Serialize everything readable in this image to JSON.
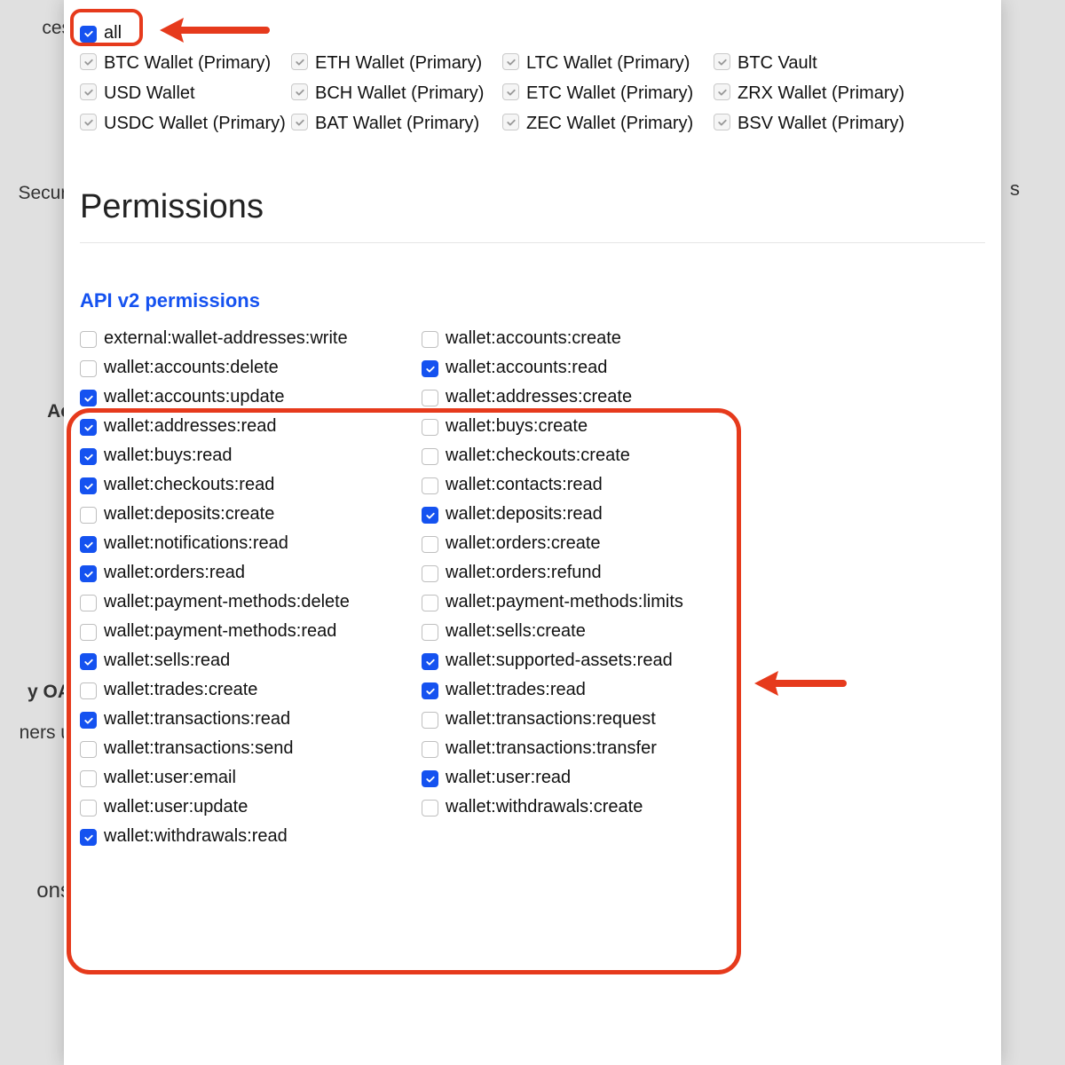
{
  "background": {
    "left_items": [
      "ces",
      "Securi",
      "Ac",
      "y OA",
      "ners u",
      "ons"
    ],
    "right_items": [
      "s"
    ]
  },
  "accounts": {
    "all_label": "all",
    "all_checked": true,
    "items": [
      {
        "label": "BTC Wallet (Primary)",
        "checked": true
      },
      {
        "label": "ETH Wallet (Primary)",
        "checked": true
      },
      {
        "label": "LTC Wallet (Primary)",
        "checked": true
      },
      {
        "label": "BTC Vault",
        "checked": true
      },
      {
        "label": "USD Wallet",
        "checked": true
      },
      {
        "label": "BCH Wallet (Primary)",
        "checked": true
      },
      {
        "label": "ETC Wallet (Primary)",
        "checked": true
      },
      {
        "label": "ZRX Wallet (Primary)",
        "checked": true
      },
      {
        "label": "USDC Wallet (Primary)",
        "checked": true
      },
      {
        "label": "BAT Wallet (Primary)",
        "checked": true
      },
      {
        "label": "ZEC Wallet (Primary)",
        "checked": true
      },
      {
        "label": "BSV Wallet (Primary)",
        "checked": true
      }
    ]
  },
  "headings": {
    "permissions": "Permissions",
    "api_v2": "API v2 permissions"
  },
  "permissions": [
    {
      "label": "external:wallet-addresses:write",
      "checked": false
    },
    {
      "label": "wallet:accounts:create",
      "checked": false
    },
    {
      "label": "wallet:accounts:delete",
      "checked": false
    },
    {
      "label": "wallet:accounts:read",
      "checked": true
    },
    {
      "label": "wallet:accounts:update",
      "checked": true
    },
    {
      "label": "wallet:addresses:create",
      "checked": false
    },
    {
      "label": "wallet:addresses:read",
      "checked": true
    },
    {
      "label": "wallet:buys:create",
      "checked": false
    },
    {
      "label": "wallet:buys:read",
      "checked": true
    },
    {
      "label": "wallet:checkouts:create",
      "checked": false
    },
    {
      "label": "wallet:checkouts:read",
      "checked": true
    },
    {
      "label": "wallet:contacts:read",
      "checked": false
    },
    {
      "label": "wallet:deposits:create",
      "checked": false
    },
    {
      "label": "wallet:deposits:read",
      "checked": true
    },
    {
      "label": "wallet:notifications:read",
      "checked": true
    },
    {
      "label": "wallet:orders:create",
      "checked": false
    },
    {
      "label": "wallet:orders:read",
      "checked": true
    },
    {
      "label": "wallet:orders:refund",
      "checked": false
    },
    {
      "label": "wallet:payment-methods:delete",
      "checked": false
    },
    {
      "label": "wallet:payment-methods:limits",
      "checked": false
    },
    {
      "label": "wallet:payment-methods:read",
      "checked": false
    },
    {
      "label": "wallet:sells:create",
      "checked": false
    },
    {
      "label": "wallet:sells:read",
      "checked": true
    },
    {
      "label": "wallet:supported-assets:read",
      "checked": true
    },
    {
      "label": "wallet:trades:create",
      "checked": false
    },
    {
      "label": "wallet:trades:read",
      "checked": true
    },
    {
      "label": "wallet:transactions:read",
      "checked": true
    },
    {
      "label": "wallet:transactions:request",
      "checked": false
    },
    {
      "label": "wallet:transactions:send",
      "checked": false
    },
    {
      "label": "wallet:transactions:transfer",
      "checked": false
    },
    {
      "label": "wallet:user:email",
      "checked": false
    },
    {
      "label": "wallet:user:read",
      "checked": true
    },
    {
      "label": "wallet:user:update",
      "checked": false
    },
    {
      "label": "wallet:withdrawals:create",
      "checked": false
    },
    {
      "label": "wallet:withdrawals:read",
      "checked": true
    }
  ]
}
